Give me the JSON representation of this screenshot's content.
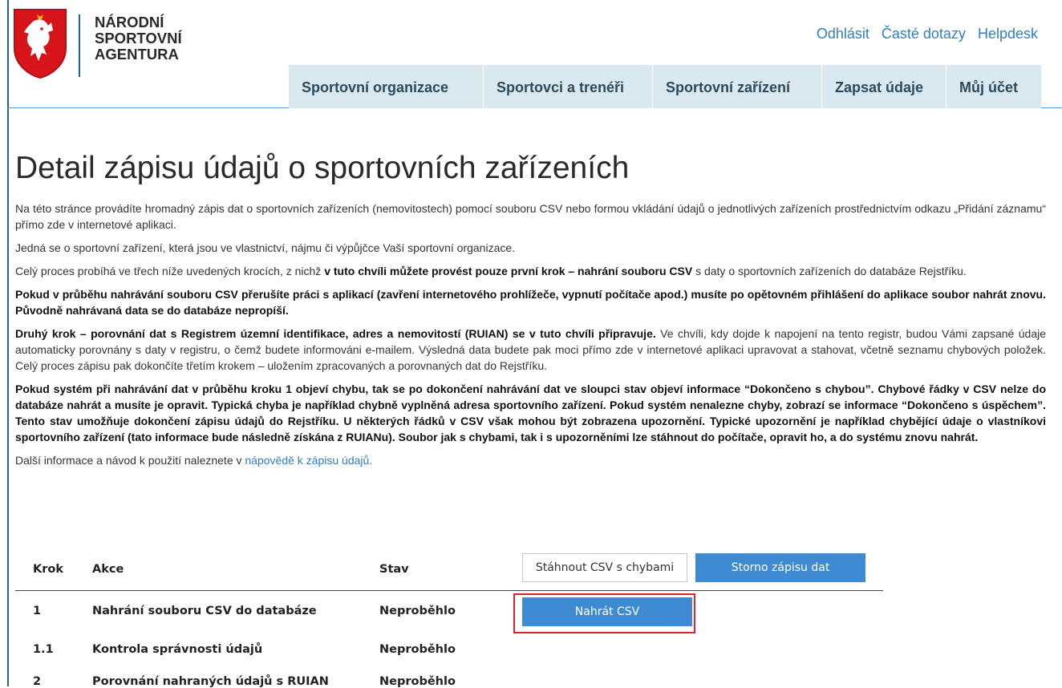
{
  "brand": {
    "name_lines": [
      "NÁRODNÍ",
      "SPORTOVNÍ",
      "AGENTURA"
    ],
    "logo_icon": "czech-coat-of-arms-icon",
    "accent": "#1f5fa8"
  },
  "top_links": [
    "Odhlásit",
    "Časté dotazy",
    "Helpdesk"
  ],
  "nav": [
    "Sportovní organizace",
    "Sportovci a trenéři",
    "Sportovní zařízení",
    "Zapsat údaje",
    "Můj účet"
  ],
  "page_title": "Detail zápisu údajů o sportovních zařízeních",
  "intro": {
    "p1": "Na této stránce provádíte hromadný zápis dat o sportovních zařízeních (nemovitostech) pomocí souboru CSV nebo formou vkládání údajů o jednotlivých zařízeních prostřednictvím odkazu „Přidání záznamu“ přímo zde v internetové aplikaci.",
    "p2": "Jedná se o sportovní zařízení, která jsou ve vlastnictví, nájmu či výpůjčce Vaší sportovní organizace.",
    "p3_a": "Celý proces probíhá ve třech níže uvedených krocích, z nichž ",
    "p3_b": "v tuto chvíli můžete provést pouze první krok – nahrání souboru CSV",
    "p3_c": " s daty o sportovních zařízeních do databáze Rejstříku.",
    "p4": "Pokud v průběhu nahrávání souboru CSV přerušíte práci s aplikací (zavření internetového prohlížeče, vypnutí počítače apod.) musíte po opětovném přihlášení do aplikace soubor nahrát znovu. Původně nahrávaná data se do databáze nepropíší.",
    "p5_a": "Druhý krok – porovnání dat s Registrem územní identifikace, adres a nemovitostí (RUIAN) se v tuto chvíli připravuje.",
    "p5_b": " Ve chvíli, kdy dojde k napojení na tento registr, budou Vámi zapsané údaje automaticky porovnány s daty v registru, o čemž budete informováni e-mailem. Výsledná data budete pak moci přímo zde v internetové aplikaci upravovat a stahovat, včetně seznamu chybových položek. Celý proces zápisu pak dokončíte třetím krokem – uložením zpracovaných a porovnaných dat do Rejstříku.",
    "p6": "Pokud systém při nahrávání dat v průběhu kroku 1 objeví chybu, tak se po dokončení nahrávání dat ve sloupci stav objeví informace “Dokončeno s chybou”. Chybové řádky v CSV nelze do databáze nahrát a musíte je opravit. Typická chyba je například chybně vyplněná adresa sportovního zařízení. Pokud systém nenalezne chyby, zobrazí se informace “Dokončeno s úspěchem”. Tento stav umožňuje dokončení zápisu údajů do Rejstříku. U některých řádků v CSV však mohou být zobrazena upozornění. Typické upozornění je například chybějící údaje o vlastníkovi sportovního zařízení (tato informace bude následně získána z RUIANu). Soubor jak s chybami, tak i s upozorněními lze stáhnout do počítače, opravit ho, a do systému znovu nahrát.",
    "p7_a": "Další informace a návod k použití naleznete v ",
    "p7_link": "nápovědě k zápisu údajů."
  },
  "steps": {
    "headers": {
      "krok": "Krok",
      "akce": "Akce",
      "stav": "Stav"
    },
    "download_button": "Stáhnout CSV s chybami",
    "cancel_button": "Storno zápisu dat",
    "upload_button": "Nahrát CSV",
    "rows": [
      {
        "krok": "1",
        "akce": "Nahrání souboru CSV do databáze",
        "stav": "Neproběhlo"
      },
      {
        "krok": "1.1",
        "akce": "Kontrola správnosti údajů",
        "stav": "Neproběhlo"
      },
      {
        "krok": "2",
        "akce": "Porovnání nahraných údajů s RUIAN",
        "stav": "Neproběhlo"
      }
    ]
  }
}
